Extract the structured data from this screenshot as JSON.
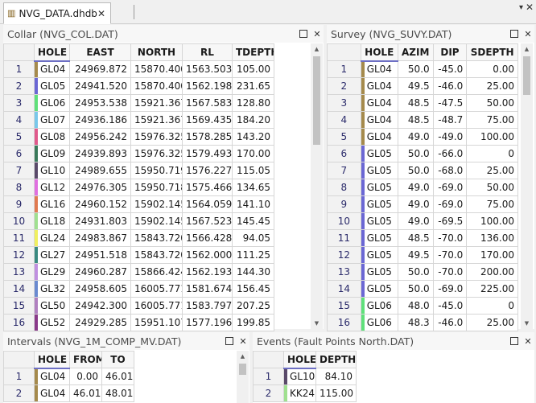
{
  "tab": {
    "label": "NVG_DATA.dhdb",
    "close": "✕",
    "menu": "▾",
    "window_close": "✕"
  },
  "collar": {
    "title": "Collar (NVG_COL.DAT)",
    "columns": [
      "HOLE",
      "EAST",
      "NORTH",
      "RL",
      "TDEPTH"
    ],
    "rows": [
      {
        "n": "1",
        "hole": "GL04",
        "color": "#a58a4c",
        "v": [
          "24969.872",
          "15870.400",
          "1563.503",
          "105.00"
        ]
      },
      {
        "n": "2",
        "hole": "GL05",
        "color": "#6b67d4",
        "v": [
          "24941.520",
          "15870.400",
          "1562.198",
          "231.65"
        ]
      },
      {
        "n": "3",
        "hole": "GL06",
        "color": "#5fe07a",
        "v": [
          "24953.538",
          "15921.367",
          "1567.583",
          "128.80"
        ]
      },
      {
        "n": "4",
        "hole": "GL07",
        "color": "#79c8ea",
        "v": [
          "24936.186",
          "15921.367",
          "1569.435",
          "184.20"
        ]
      },
      {
        "n": "5",
        "hole": "GL08",
        "color": "#e05a8c",
        "v": [
          "24956.242",
          "15976.325",
          "1578.285",
          "143.20"
        ]
      },
      {
        "n": "6",
        "hole": "GL09",
        "color": "#3a7a5a",
        "v": [
          "24939.893",
          "15976.325",
          "1579.493",
          "170.00"
        ]
      },
      {
        "n": "7",
        "hole": "GL10",
        "color": "#5a4a6a",
        "v": [
          "24989.655",
          "15950.719",
          "1576.227",
          "115.05"
        ]
      },
      {
        "n": "8",
        "hole": "GL12",
        "color": "#e070e0",
        "v": [
          "24976.305",
          "15950.718",
          "1575.466",
          "134.65"
        ]
      },
      {
        "n": "9",
        "hole": "GL16",
        "color": "#e07a50",
        "v": [
          "24960.152",
          "15902.145",
          "1564.059",
          "141.10"
        ]
      },
      {
        "n": "10",
        "hole": "GL18",
        "color": "#a0e090",
        "v": [
          "24931.803",
          "15902.145",
          "1567.523",
          "145.45"
        ]
      },
      {
        "n": "11",
        "hole": "GL24",
        "color": "#f0f060",
        "v": [
          "24983.867",
          "15843.720",
          "1566.428",
          "94.05"
        ]
      },
      {
        "n": "12",
        "hole": "GL27",
        "color": "#3a8a80",
        "v": [
          "24951.518",
          "15843.720",
          "1562.000",
          "111.25"
        ]
      },
      {
        "n": "13",
        "hole": "GL29",
        "color": "#c090e0",
        "v": [
          "24960.287",
          "15866.424",
          "1562.193",
          "144.30"
        ]
      },
      {
        "n": "14",
        "hole": "GL32",
        "color": "#6a8ad0",
        "v": [
          "24958.605",
          "16005.771",
          "1581.674",
          "156.45"
        ]
      },
      {
        "n": "15",
        "hole": "GL50",
        "color": "#b080c0",
        "v": [
          "24942.300",
          "16005.771",
          "1583.797",
          "207.25"
        ]
      },
      {
        "n": "16",
        "hole": "GL52",
        "color": "#8a3a8a",
        "v": [
          "24929.285",
          "15951.107",
          "1577.196",
          "199.85"
        ]
      }
    ]
  },
  "survey": {
    "title": "Survey (NVG_SUVY.DAT)",
    "columns": [
      "HOLE",
      "AZIM",
      "DIP",
      "SDEPTH"
    ],
    "rows": [
      {
        "n": "1",
        "hole": "GL04",
        "color": "#a58a4c",
        "v": [
          "50.0",
          "-45.0",
          "0.00"
        ]
      },
      {
        "n": "2",
        "hole": "GL04",
        "color": "#a58a4c",
        "v": [
          "49.5",
          "-46.0",
          "25.00"
        ]
      },
      {
        "n": "3",
        "hole": "GL04",
        "color": "#a58a4c",
        "v": [
          "48.5",
          "-47.5",
          "50.00"
        ]
      },
      {
        "n": "4",
        "hole": "GL04",
        "color": "#a58a4c",
        "v": [
          "48.5",
          "-48.7",
          "75.00"
        ]
      },
      {
        "n": "5",
        "hole": "GL04",
        "color": "#a58a4c",
        "v": [
          "49.0",
          "-49.0",
          "100.00"
        ]
      },
      {
        "n": "6",
        "hole": "GL05",
        "color": "#6b67d4",
        "v": [
          "50.0",
          "-66.0",
          "0"
        ]
      },
      {
        "n": "7",
        "hole": "GL05",
        "color": "#6b67d4",
        "v": [
          "50.0",
          "-68.0",
          "25.00"
        ]
      },
      {
        "n": "8",
        "hole": "GL05",
        "color": "#6b67d4",
        "v": [
          "49.0",
          "-69.0",
          "50.00"
        ]
      },
      {
        "n": "9",
        "hole": "GL05",
        "color": "#6b67d4",
        "v": [
          "49.0",
          "-69.0",
          "75.00"
        ]
      },
      {
        "n": "10",
        "hole": "GL05",
        "color": "#6b67d4",
        "v": [
          "49.0",
          "-69.5",
          "100.00"
        ]
      },
      {
        "n": "11",
        "hole": "GL05",
        "color": "#6b67d4",
        "v": [
          "48.5",
          "-70.0",
          "136.00"
        ]
      },
      {
        "n": "12",
        "hole": "GL05",
        "color": "#6b67d4",
        "v": [
          "49.5",
          "-70.0",
          "170.00"
        ]
      },
      {
        "n": "13",
        "hole": "GL05",
        "color": "#6b67d4",
        "v": [
          "50.0",
          "-70.0",
          "200.00"
        ]
      },
      {
        "n": "14",
        "hole": "GL05",
        "color": "#6b67d4",
        "v": [
          "50.0",
          "-69.0",
          "225.00"
        ]
      },
      {
        "n": "15",
        "hole": "GL06",
        "color": "#5fe07a",
        "v": [
          "48.0",
          "-45.0",
          "0"
        ]
      },
      {
        "n": "16",
        "hole": "GL06",
        "color": "#5fe07a",
        "v": [
          "48.3",
          "-46.0",
          "25.00"
        ]
      }
    ]
  },
  "intervals": {
    "title": "Intervals (NVG_1M_COMP_MV.DAT)",
    "columns": [
      "HOLE",
      "FROM",
      "TO"
    ],
    "rows": [
      {
        "n": "1",
        "hole": "GL04",
        "color": "#a58a4c",
        "v": [
          "0.00",
          "46.01"
        ]
      },
      {
        "n": "2",
        "hole": "GL04",
        "color": "#a58a4c",
        "v": [
          "46.01",
          "48.01"
        ]
      }
    ]
  },
  "events": {
    "title": "Events (Fault Points North.DAT)",
    "columns": [
      "HOLE",
      "DEPTH"
    ],
    "rows": [
      {
        "n": "1",
        "hole": "GL10",
        "color": "#5a4a6a",
        "v": [
          "84.10"
        ]
      },
      {
        "n": "2",
        "hole": "KK24",
        "color": "#a0e090",
        "v": [
          "115.00"
        ]
      }
    ]
  },
  "panel_buttons": {
    "maximize": "",
    "close": "✕"
  }
}
